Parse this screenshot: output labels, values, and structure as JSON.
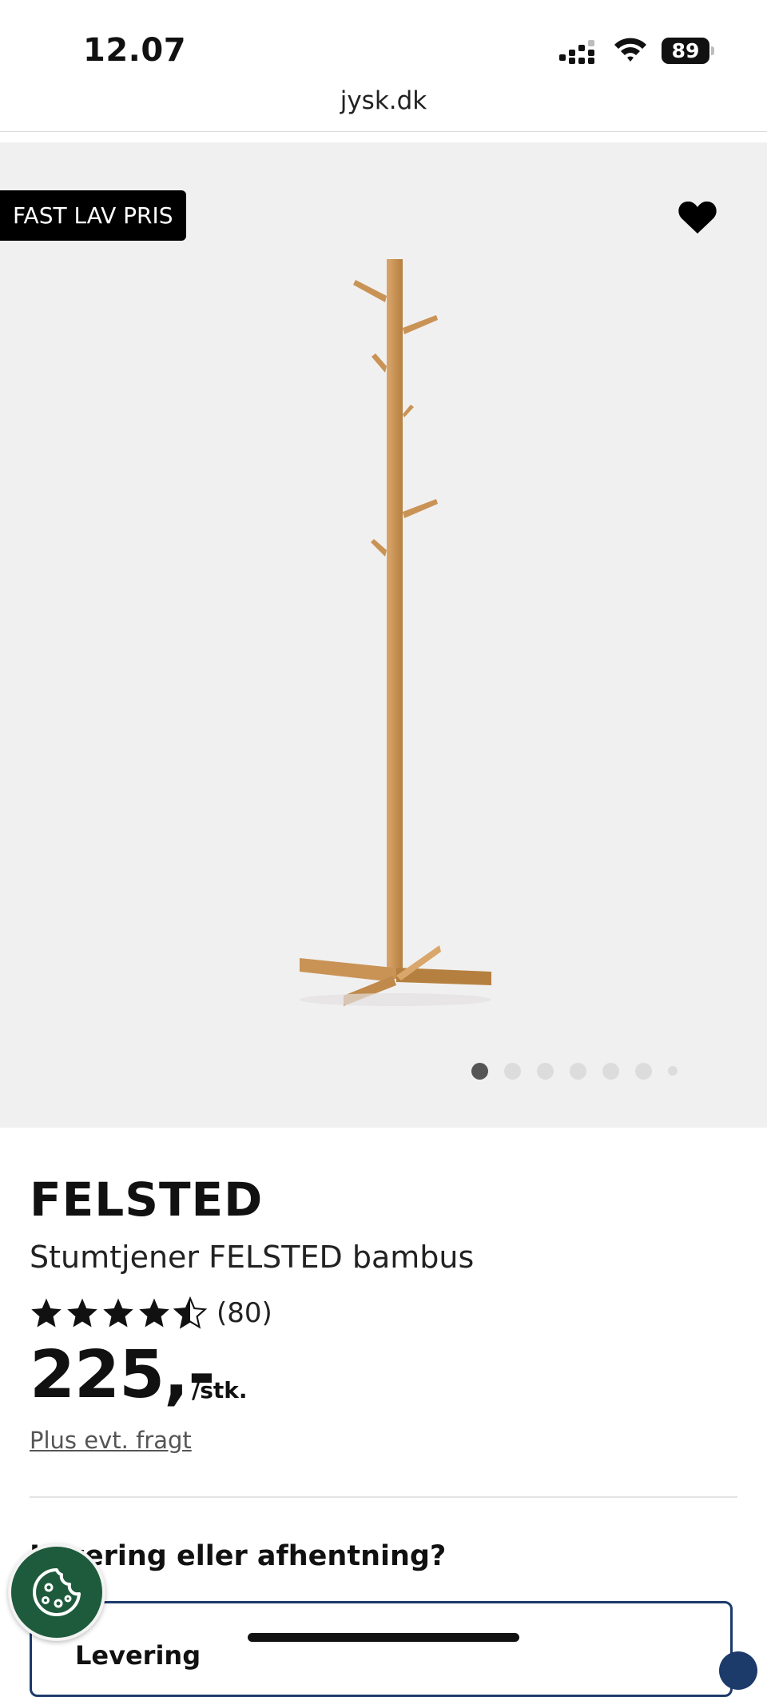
{
  "status_bar": {
    "time": "12.07",
    "battery": "89"
  },
  "browser": {
    "url": "jysk.dk"
  },
  "gallery": {
    "badge": "FAST LAV PRIS",
    "favorite_icon": "heart-icon",
    "image_count": 7,
    "active_index": 0
  },
  "product": {
    "brand": "FELSTED",
    "name": "Stumtjener FELSTED bambus",
    "rating": 4.5,
    "max_rating": 5,
    "review_count": "(80)",
    "price": "225,-",
    "unit": "/stk.",
    "shipping_note": "Plus evt. fragt"
  },
  "delivery": {
    "heading": "Levering eller afhentning?",
    "option_label": "Levering"
  },
  "cookie": {
    "icon": "cookie-icon"
  },
  "colors": {
    "accent": "#1c3a6a",
    "cookie": "#1e5b3c",
    "badge_bg": "#000000"
  }
}
